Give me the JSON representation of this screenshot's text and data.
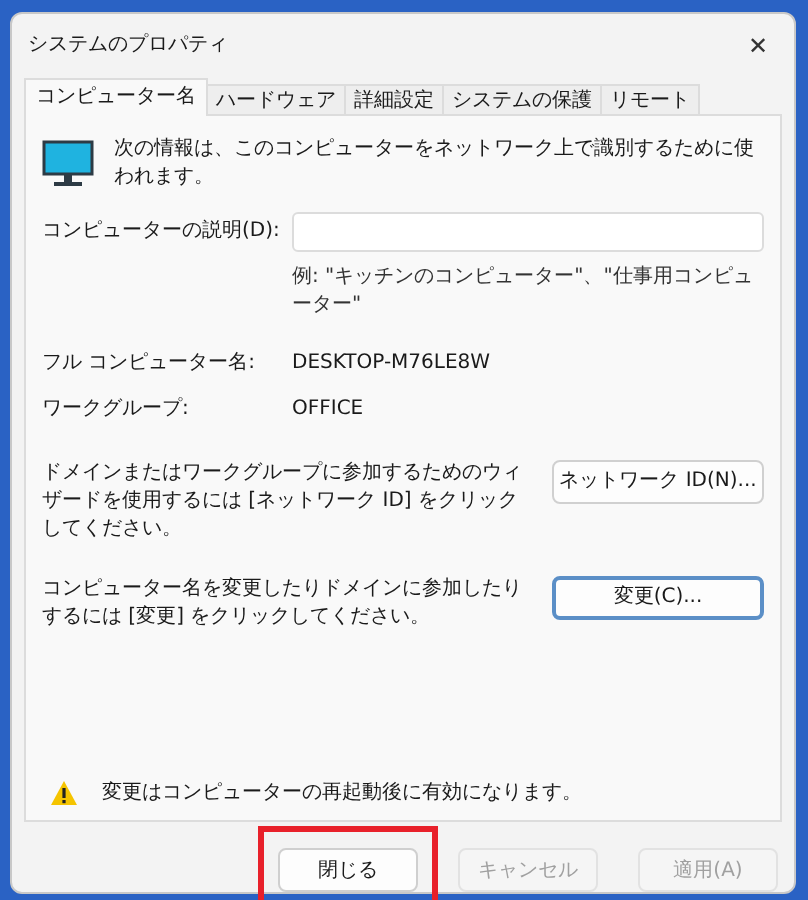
{
  "window": {
    "title": "システムのプロパティ",
    "close_glyph": "✕"
  },
  "tabs": [
    {
      "label": "コンピューター名",
      "selected": true
    },
    {
      "label": "ハードウェア",
      "selected": false
    },
    {
      "label": "詳細設定",
      "selected": false
    },
    {
      "label": "システムの保護",
      "selected": false
    },
    {
      "label": "リモート",
      "selected": false
    }
  ],
  "intro": "次の情報は、このコンピューターをネットワーク上で識別するために使われます。",
  "description": {
    "label": "コンピューターの説明(D):",
    "example": "例: \"キッチンのコンピューター\"、\"仕事用コンピューター\""
  },
  "info": [
    {
      "label": "フル コンピューター名:",
      "value": "DESKTOP-M76LE8W"
    },
    {
      "label": "ワークグループ:",
      "value": "OFFICE"
    }
  ],
  "actions": [
    {
      "text": "ドメインまたはワークグループに参加するためのウィザードを使用するには [ネットワーク ID] をクリックしてください。",
      "button": "ネットワーク ID(N)...",
      "focused": false
    },
    {
      "text": "コンピューター名を変更したりドメインに参加したりするには [変更] をクリックしてください。",
      "button": "変更(C)...",
      "focused": true
    }
  ],
  "notice": "変更はコンピューターの再起動後に有効になります。",
  "buttons": [
    {
      "label": "閉じる",
      "disabled": false,
      "highlighted": true
    },
    {
      "label": "キャンセル",
      "disabled": true,
      "highlighted": false
    },
    {
      "label": "適用(A)",
      "disabled": true,
      "highlighted": false
    }
  ]
}
